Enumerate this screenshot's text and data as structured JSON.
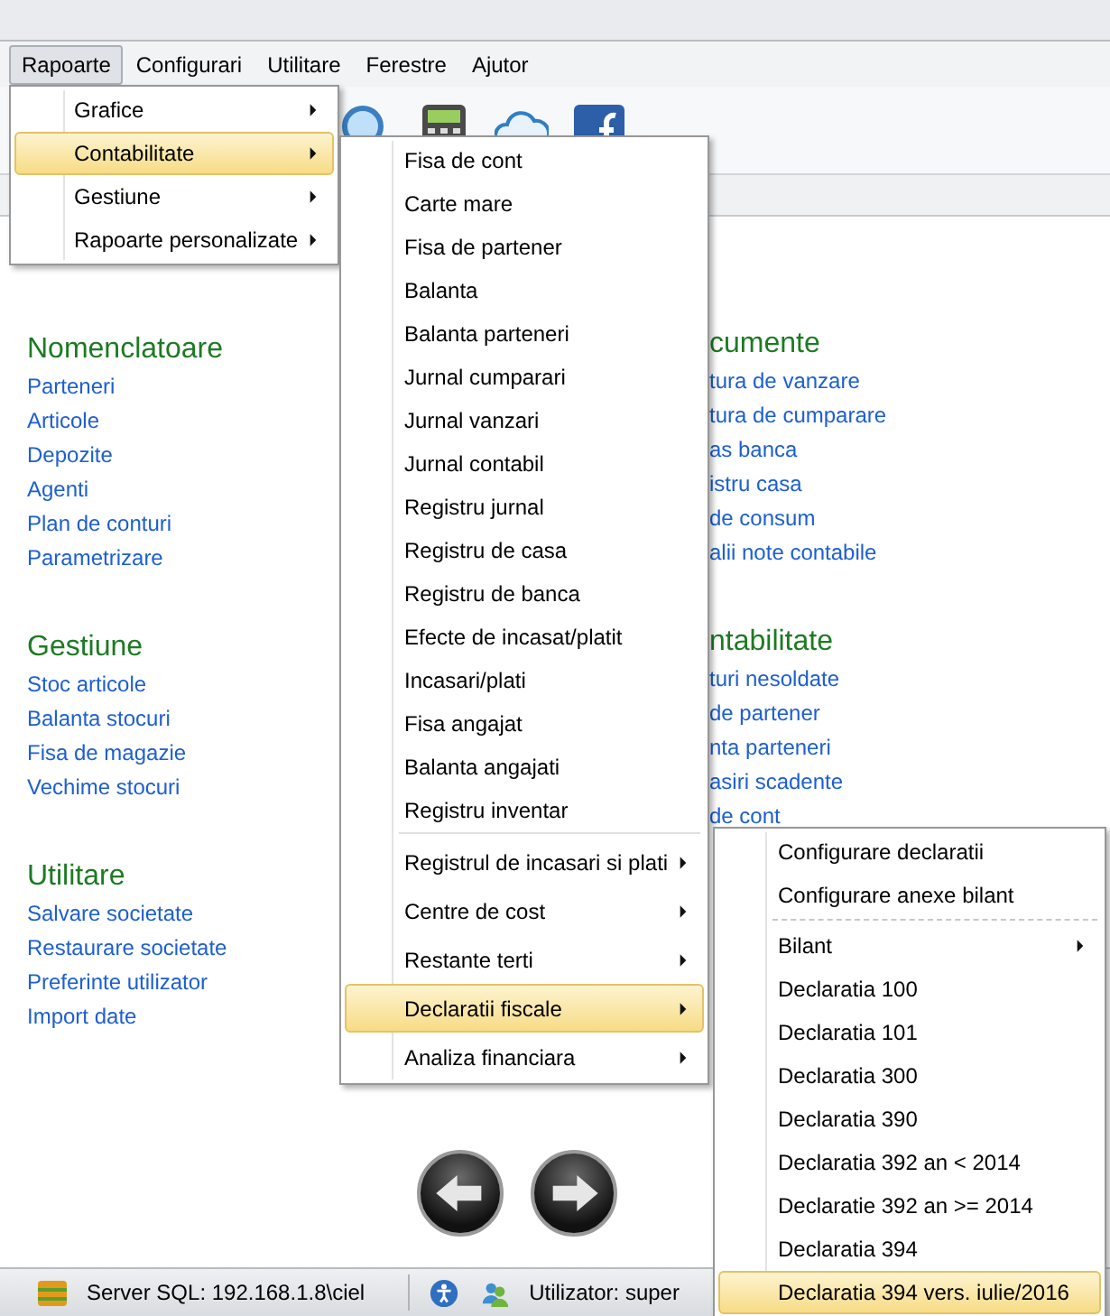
{
  "menubar": [
    {
      "label": "Rapoarte",
      "selected": true
    },
    {
      "label": "Configurari",
      "selected": false
    },
    {
      "label": "Utilitare",
      "selected": false
    },
    {
      "label": "Ferestre",
      "selected": false
    },
    {
      "label": "Ajutor",
      "selected": false
    }
  ],
  "sections_left": [
    {
      "title": "Nomenclatoare",
      "links": [
        "Parteneri",
        "Articole",
        "Depozite",
        "Agenti",
        "Plan de conturi",
        "Parametrizare"
      ]
    },
    {
      "title": "Gestiune",
      "links": [
        "Stoc articole",
        "Balanta stocuri",
        "Fisa de magazie",
        "Vechime stocuri"
      ]
    },
    {
      "title": "Utilitare",
      "links": [
        "Salvare societate",
        "Restaurare societate",
        "Preferinte utilizator",
        "Import date"
      ]
    }
  ],
  "sections_right": [
    {
      "title": "cumente",
      "links": [
        "tura de vanzare",
        "tura de cumparare",
        "as banca",
        "istru casa",
        "de consum",
        "alii note contabile"
      ]
    },
    {
      "title": "ntabilitate",
      "links": [
        "turi nesoldate",
        "de partener",
        "nta parteneri",
        "asiri scadente",
        "de cont"
      ]
    }
  ],
  "menus": [
    {
      "items": [
        {
          "kind": "submenu",
          "label": "Grafice",
          "selected": false
        },
        {
          "kind": "submenu",
          "label": "Contabilitate",
          "selected": true
        },
        {
          "kind": "submenu",
          "label": "Gestiune",
          "selected": false
        },
        {
          "kind": "submenu",
          "label": "Rapoarte personalizate",
          "selected": false
        }
      ]
    },
    {
      "items": [
        {
          "kind": "item",
          "label": "Fisa de cont",
          "selected": false
        },
        {
          "kind": "item",
          "label": "Carte mare",
          "selected": false
        },
        {
          "kind": "item",
          "label": "Fisa de partener",
          "selected": false
        },
        {
          "kind": "item",
          "label": "Balanta",
          "selected": false
        },
        {
          "kind": "item",
          "label": "Balanta parteneri",
          "selected": false
        },
        {
          "kind": "item",
          "label": "Jurnal cumparari",
          "selected": false
        },
        {
          "kind": "item",
          "label": "Jurnal vanzari",
          "selected": false
        },
        {
          "kind": "item",
          "label": "Jurnal contabil",
          "selected": false
        },
        {
          "kind": "item",
          "label": "Registru jurnal",
          "selected": false
        },
        {
          "kind": "item",
          "label": "Registru de casa",
          "selected": false
        },
        {
          "kind": "item",
          "label": "Registru de banca",
          "selected": false
        },
        {
          "kind": "item",
          "label": "Efecte de incasat/platit",
          "selected": false
        },
        {
          "kind": "item",
          "label": "Incasari/plati",
          "selected": false
        },
        {
          "kind": "item",
          "label": "Fisa angajat",
          "selected": false
        },
        {
          "kind": "item",
          "label": "Balanta angajati",
          "selected": false
        },
        {
          "kind": "item",
          "label": "Registru inventar",
          "selected": false
        },
        {
          "kind": "separator"
        },
        {
          "kind": "submenu",
          "label": "Registrul de incasari si plati",
          "selected": false
        },
        {
          "kind": "submenu",
          "label": "Centre de cost",
          "selected": false
        },
        {
          "kind": "submenu",
          "label": "Restante terti",
          "selected": false
        },
        {
          "kind": "submenu",
          "label": "Declaratii fiscale",
          "selected": true
        },
        {
          "kind": "submenu",
          "label": "Analiza financiara",
          "selected": false
        }
      ]
    },
    {
      "items": [
        {
          "kind": "item",
          "label": "Configurare declaratii",
          "selected": false
        },
        {
          "kind": "item",
          "label": "Configurare anexe bilant",
          "selected": false
        },
        {
          "kind": "separator"
        },
        {
          "kind": "submenu",
          "label": "Bilant",
          "selected": false
        },
        {
          "kind": "item",
          "label": "Declaratia 100",
          "selected": false
        },
        {
          "kind": "item",
          "label": "Declaratia 101",
          "selected": false
        },
        {
          "kind": "item",
          "label": "Declaratia 300",
          "selected": false
        },
        {
          "kind": "item",
          "label": "Declaratia 390",
          "selected": false
        },
        {
          "kind": "item",
          "label": "Declaratia 392 an < 2014",
          "selected": false
        },
        {
          "kind": "item",
          "label": "Declaratie 392 an >= 2014",
          "selected": false
        },
        {
          "kind": "item",
          "label": "Declaratia 394",
          "selected": false
        },
        {
          "kind": "item",
          "label": "Declaratia 394 vers. iulie/2016",
          "selected": true
        }
      ]
    }
  ],
  "status_bar": {
    "server": "Server SQL: 192.168.1.8\\ciel",
    "user": "Utilizator: super"
  }
}
